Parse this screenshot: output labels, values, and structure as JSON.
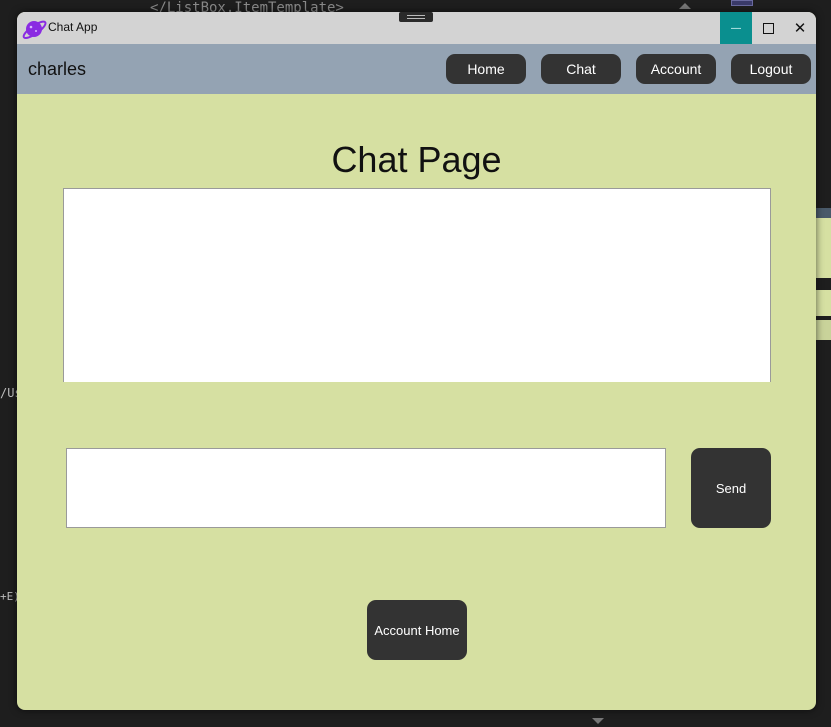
{
  "window": {
    "title": "Chat App",
    "controls": {
      "minimize_icon": "minimize-icon",
      "maximize_icon": "maximize-icon",
      "close_icon": "close-icon"
    },
    "close_glyph": "✕",
    "minimize_glyph": "—"
  },
  "navbar": {
    "username": "charles",
    "buttons": [
      "Home",
      "Chat",
      "Account",
      "Logout"
    ]
  },
  "main": {
    "title": "Chat Page",
    "send_label": "Send",
    "account_home_label": "Account Home"
  },
  "background": {
    "code_line": "</ListBox.ItemTemplate>",
    "left_fragment_1": "/Us",
    "left_fragment_2": "+E)"
  },
  "colors": {
    "window_bg": "#d6e0a2",
    "navbar_bg": "#94a3b3",
    "button_bg": "#333333",
    "minimize_bg": "#0a8f8f"
  }
}
